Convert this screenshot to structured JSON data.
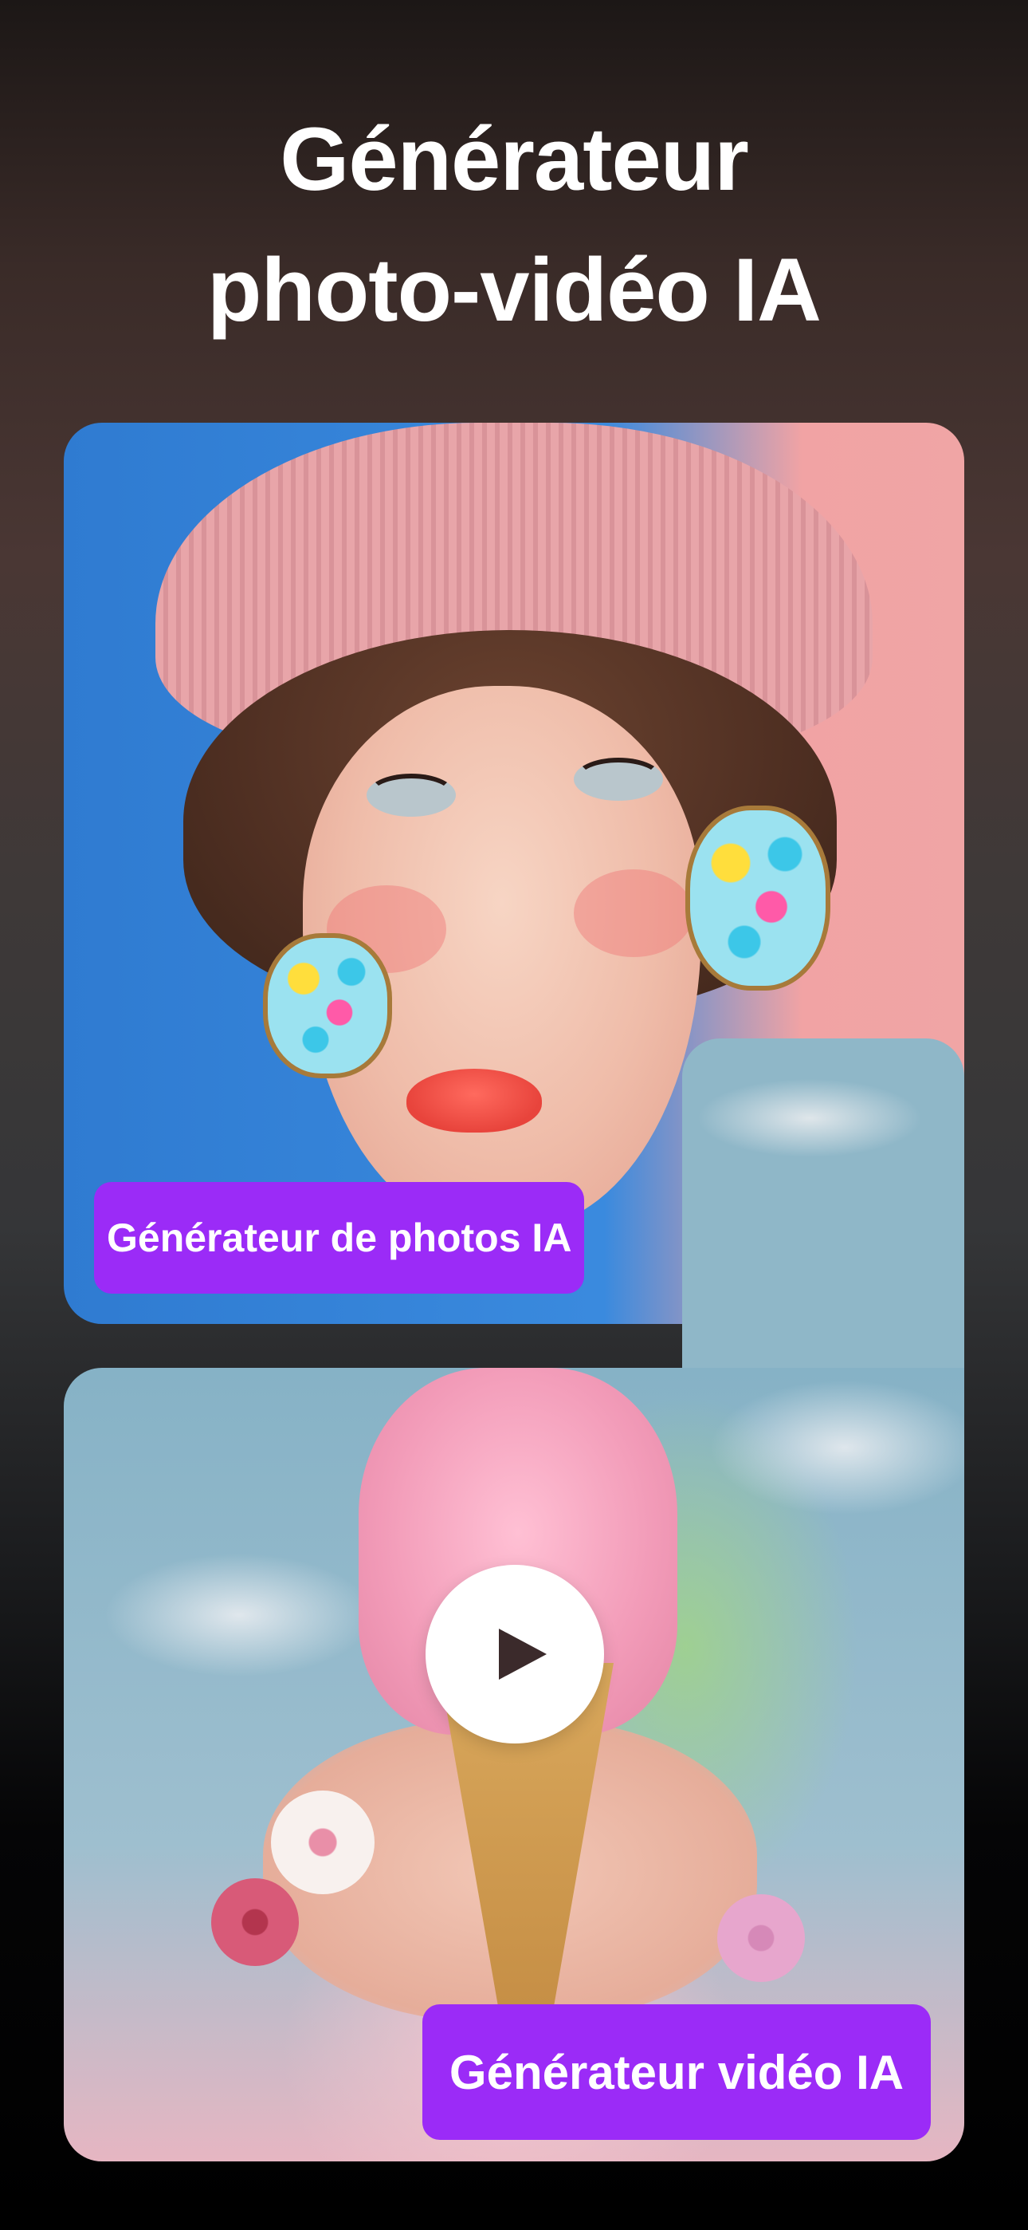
{
  "header": {
    "title_line1": "Générateur",
    "title_line2": "photo-vidéo IA"
  },
  "photo_card": {
    "label": "Générateur de photos IA"
  },
  "video_card": {
    "label": "Générateur vidéo IA",
    "play_icon": "play-icon"
  },
  "colors": {
    "accent": "#9b2bf7",
    "background_top": "#2a1f1d",
    "background_bottom": "#000000"
  }
}
